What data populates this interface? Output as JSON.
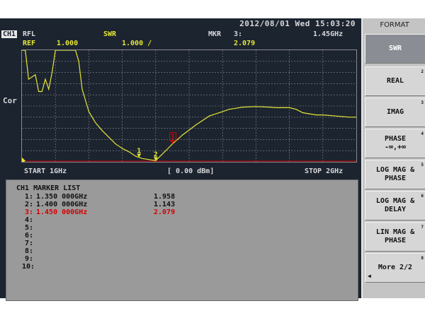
{
  "status": {
    "datetime": "2012/08/01 Wed 15:03:20"
  },
  "header": {
    "channel": "CH1",
    "measurement": "RFL",
    "format": "SWR",
    "ref_label": "REF",
    "ref_value": "1.000",
    "scale_value": "1.000 /",
    "marker_label": "MKR",
    "marker_id": "3:",
    "marker_freq": "1.45GHz",
    "marker_value": "2.079",
    "side_label": "Cor"
  },
  "axis": {
    "start": "START 1GHz",
    "power": "[ 0.00 dBm]",
    "stop": "STOP 2GHz"
  },
  "colors": {
    "trace": "#e6e635",
    "grid": "#8a8a8a",
    "active_marker": "#d40000",
    "background": "#1c2430"
  },
  "chart_data": {
    "type": "line",
    "x_unit": "GHz",
    "xlim": [
      1.0,
      2.0
    ],
    "ylim": [
      0,
      10
    ],
    "grid": true,
    "x": [
      1.0,
      1.01,
      1.02,
      1.04,
      1.05,
      1.06,
      1.07,
      1.08,
      1.09,
      1.1,
      1.11,
      1.12,
      1.13,
      1.14,
      1.16,
      1.17,
      1.18,
      1.2,
      1.22,
      1.24,
      1.26,
      1.28,
      1.3,
      1.32,
      1.34,
      1.35,
      1.36,
      1.38,
      1.4,
      1.42,
      1.44,
      1.45,
      1.48,
      1.52,
      1.56,
      1.6,
      1.62,
      1.64,
      1.66,
      1.7,
      1.74,
      1.76,
      1.78,
      1.8,
      1.82,
      1.84,
      1.86,
      1.88,
      1.9,
      1.94,
      1.98,
      2.0
    ],
    "y": [
      10.0,
      10.0,
      7.4,
      7.8,
      6.3,
      6.3,
      7.4,
      6.5,
      8.0,
      10.0,
      10.0,
      10.0,
      10.0,
      10.0,
      10.0,
      9.0,
      6.5,
      4.5,
      3.5,
      2.8,
      2.2,
      1.6,
      1.2,
      0.9,
      0.5,
      0.4,
      0.3,
      0.2,
      0.1,
      0.7,
      1.3,
      1.6,
      2.4,
      3.3,
      4.1,
      4.5,
      4.7,
      4.8,
      4.9,
      4.95,
      4.9,
      4.85,
      4.85,
      4.85,
      4.7,
      4.4,
      4.3,
      4.2,
      4.2,
      4.1,
      4.0,
      4.0
    ],
    "markers": [
      {
        "id": "1",
        "x": 1.35,
        "value": "1.958",
        "active": false
      },
      {
        "id": "2",
        "x": 1.4,
        "value": "1.143",
        "active": false
      },
      {
        "id": "3",
        "x": 1.45,
        "value": "2.079",
        "active": true
      }
    ]
  },
  "marker_list": {
    "title": "CH1 MARKER LIST",
    "rows": [
      {
        "num": "1:",
        "freq": "1.350 000GHz",
        "value": "1.958"
      },
      {
        "num": "2:",
        "freq": "1.400 000GHz",
        "value": "1.143"
      },
      {
        "num": "3:",
        "freq": "1.450 000GHz",
        "value": "2.079"
      },
      {
        "num": "4:",
        "freq": "",
        "value": ""
      },
      {
        "num": "5:",
        "freq": "",
        "value": ""
      },
      {
        "num": "6:",
        "freq": "",
        "value": ""
      },
      {
        "num": "7:",
        "freq": "",
        "value": ""
      },
      {
        "num": "8:",
        "freq": "",
        "value": ""
      },
      {
        "num": "9:",
        "freq": "",
        "value": ""
      },
      {
        "num": "10:",
        "freq": "",
        "value": ""
      }
    ]
  },
  "menu": {
    "title": "FORMAT",
    "keys": [
      {
        "label": "SWR",
        "num": "",
        "selected": true
      },
      {
        "label": "REAL",
        "num": "2",
        "selected": false
      },
      {
        "label": "IMAG",
        "num": "3",
        "selected": false
      },
      {
        "label": "PHASE\n-∞,+∞",
        "num": "4",
        "selected": false
      },
      {
        "label": "LOG MAG &\nPHASE",
        "num": "5",
        "selected": false
      },
      {
        "label": "LOG MAG &\nDELAY",
        "num": "6",
        "selected": false
      },
      {
        "label": "LIN MAG &\nPHASE",
        "num": "7",
        "selected": false
      },
      {
        "label": "More 2/2",
        "num": "8",
        "selected": false
      }
    ]
  }
}
